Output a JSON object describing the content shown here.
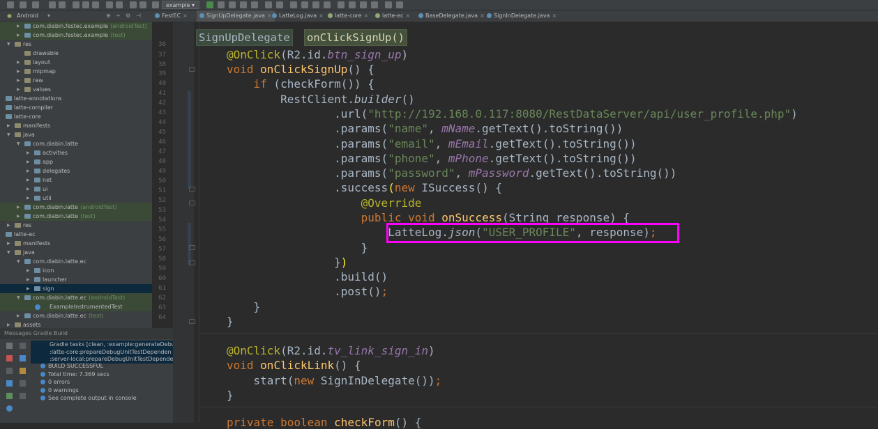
{
  "toolbar": {
    "run_config": "example"
  },
  "sidebar": {
    "view_mode": "Android",
    "tree": [
      {
        "label": "com.diabin.festec.example",
        "suffix": "(androidTest)",
        "kind": "pkg",
        "test": true
      },
      {
        "label": "com.diabin.festec.example",
        "suffix": "(test)",
        "kind": "pkg",
        "test": true
      },
      {
        "label": "res",
        "kind": "folder"
      },
      {
        "label": "drawable",
        "kind": "folder"
      },
      {
        "label": "layout",
        "kind": "folder"
      },
      {
        "label": "mipmap",
        "kind": "folder"
      },
      {
        "label": "raw",
        "kind": "folder"
      },
      {
        "label": "values",
        "kind": "folder"
      },
      {
        "label": "latte-annotations",
        "kind": "module"
      },
      {
        "label": "latte-compiler",
        "kind": "module"
      },
      {
        "label": "latte-core",
        "kind": "module"
      },
      {
        "label": "manifests",
        "kind": "folder"
      },
      {
        "label": "java",
        "kind": "folder"
      },
      {
        "label": "com.diabin.latte",
        "kind": "pkg"
      },
      {
        "label": "activities",
        "kind": "folder"
      },
      {
        "label": "app",
        "kind": "folder"
      },
      {
        "label": "delegates",
        "kind": "folder"
      },
      {
        "label": "net",
        "kind": "folder"
      },
      {
        "label": "ui",
        "kind": "folder"
      },
      {
        "label": "util",
        "kind": "folder"
      },
      {
        "label": "com.diabin.latte",
        "suffix": "(androidTest)",
        "kind": "pkg",
        "test": true
      },
      {
        "label": "com.diabin.latte",
        "suffix": "(test)",
        "kind": "pkg",
        "test": true
      },
      {
        "label": "res",
        "kind": "folder"
      },
      {
        "label": "latte-ec",
        "kind": "module"
      },
      {
        "label": "manifests",
        "kind": "folder"
      },
      {
        "label": "java",
        "kind": "folder"
      },
      {
        "label": "com.diabin.latte.ec",
        "kind": "pkg"
      },
      {
        "label": "icon",
        "kind": "folder"
      },
      {
        "label": "launcher",
        "kind": "folder"
      },
      {
        "label": "sign",
        "kind": "folder",
        "selected": true
      },
      {
        "label": "com.diabin.latte.ec",
        "suffix": "(androidTest)",
        "kind": "pkg",
        "test": true
      },
      {
        "label": "ExampleInstrumentedTest",
        "kind": "class",
        "test": true
      },
      {
        "label": "com.diabin.latte.ec",
        "suffix": "(test)",
        "kind": "pkg"
      },
      {
        "label": "assets",
        "kind": "folder"
      }
    ]
  },
  "tabs": [
    {
      "label": "FestEC"
    },
    {
      "label": "SignUpDelegate.java",
      "active": true
    },
    {
      "label": "LatteLog.java"
    },
    {
      "label": "latte-core"
    },
    {
      "label": "latte-ec"
    },
    {
      "label": "BaseDelegate.java"
    },
    {
      "label": "SignInDelegate.java"
    }
  ],
  "breadcrumb": {
    "class_name": "SignUpDelegate",
    "method_name": "onClickSignUp()"
  },
  "messages": {
    "title": "Messages Gradle Build",
    "lines": [
      "Gradle tasks [clean, :example:generateDebu",
      ":latte-core:prepareDebugUnitTestDependen",
      ":server-local:prepareDebugUnitTestDepende",
      "BUILD SUCCESSFUL",
      "Total time: 7.369 secs",
      "0 errors",
      "0 warnings",
      "See complete output in console"
    ]
  },
  "editor": {
    "line_numbers": [
      "36",
      "37",
      "38",
      "39",
      "40",
      "41",
      "42",
      "43",
      "44",
      "45",
      "46",
      "47",
      "48",
      "49",
      "50",
      "51",
      "52",
      "53",
      "54",
      "55",
      "56",
      "57",
      "58",
      "59",
      "60",
      "61",
      "62",
      "63",
      "64"
    ],
    "strings": {
      "url": "\"http://192.168.0.117:8080/RestDataServer/api/user_profile.php\"",
      "name": "\"name\"",
      "email": "\"email\"",
      "phone": "\"phone\"",
      "password": "\"password\"",
      "tag": "\"USER_PROFILE\""
    }
  }
}
